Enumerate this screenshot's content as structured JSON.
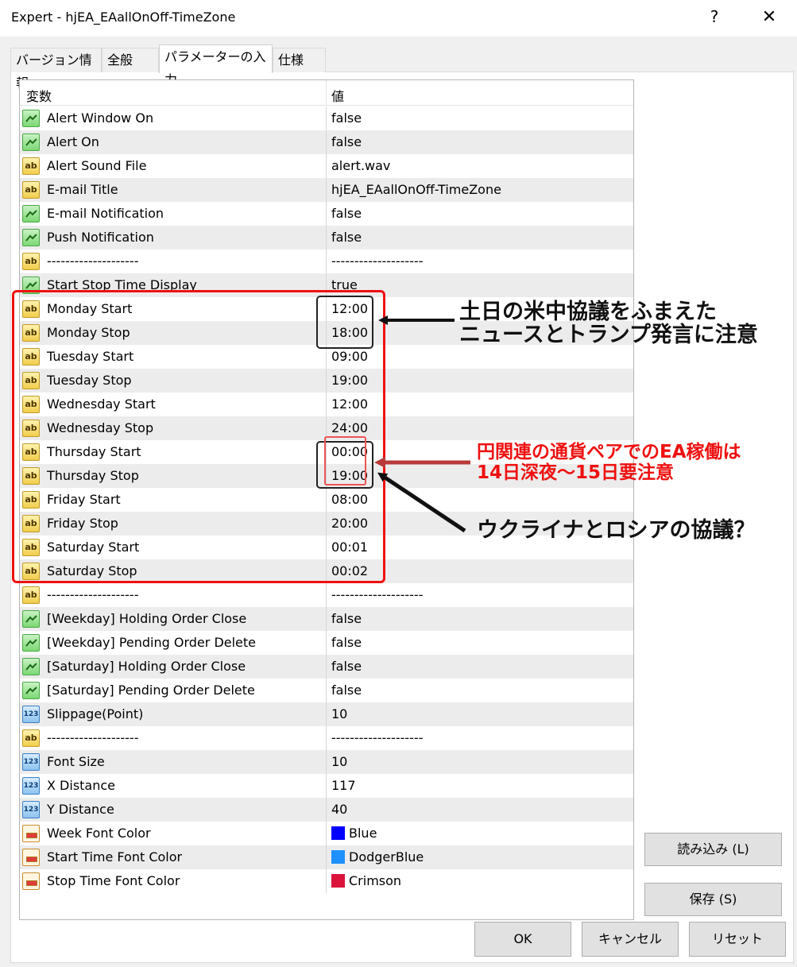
{
  "window": {
    "title": "Expert - hjEA_EAallOnOff-TimeZone",
    "help_glyph": "?",
    "close_glyph": "✕"
  },
  "tabs": [
    {
      "label": "バージョン情報"
    },
    {
      "label": "全般"
    },
    {
      "label": "パラメーターの入力",
      "active": true
    },
    {
      "label": "仕様"
    }
  ],
  "grid": {
    "col_variable": "変数",
    "col_value": "値",
    "rows": [
      {
        "type": "bool",
        "name": "Alert Window On",
        "value": "false"
      },
      {
        "type": "bool",
        "name": "Alert On",
        "value": "false"
      },
      {
        "type": "string",
        "name": "Alert Sound File",
        "value": "alert.wav"
      },
      {
        "type": "string",
        "name": "E-mail Title",
        "value": "hjEA_EAallOnOff-TimeZone"
      },
      {
        "type": "bool",
        "name": "E-mail Notification",
        "value": "false"
      },
      {
        "type": "bool",
        "name": "Push Notification",
        "value": "false"
      },
      {
        "type": "string",
        "name": "--------------------",
        "value": "--------------------"
      },
      {
        "type": "bool",
        "name": "Start Stop Time Display",
        "value": "true"
      },
      {
        "type": "string",
        "name": "Monday Start",
        "value": "12:00"
      },
      {
        "type": "string",
        "name": "Monday Stop",
        "value": "18:00"
      },
      {
        "type": "string",
        "name": "Tuesday Start",
        "value": "09:00"
      },
      {
        "type": "string",
        "name": "Tuesday Stop",
        "value": "19:00"
      },
      {
        "type": "string",
        "name": "Wednesday Start",
        "value": "12:00"
      },
      {
        "type": "string",
        "name": "Wednesday Stop",
        "value": "24:00"
      },
      {
        "type": "string",
        "name": "Thursday Start",
        "value": "00:00"
      },
      {
        "type": "string",
        "name": "Thursday Stop",
        "value": "19:00"
      },
      {
        "type": "string",
        "name": "Friday Start",
        "value": "08:00"
      },
      {
        "type": "string",
        "name": "Friday Stop",
        "value": "20:00"
      },
      {
        "type": "string",
        "name": "Saturday Start",
        "value": "00:01"
      },
      {
        "type": "string",
        "name": "Saturday Stop",
        "value": "00:02"
      },
      {
        "type": "string",
        "name": "--------------------",
        "value": "--------------------"
      },
      {
        "type": "bool",
        "name": "[Weekday]  Holding Order Close",
        "value": "false"
      },
      {
        "type": "bool",
        "name": "[Weekday]  Pending Order Delete",
        "value": "false"
      },
      {
        "type": "bool",
        "name": "[Saturday]   Holding Order Close",
        "value": "false"
      },
      {
        "type": "bool",
        "name": "[Saturday]   Pending Order Delete",
        "value": "false"
      },
      {
        "type": "int",
        "name": "Slippage(Point)",
        "value": "10"
      },
      {
        "type": "string",
        "name": "--------------------",
        "value": "--------------------"
      },
      {
        "type": "int",
        "name": "Font Size",
        "value": "10"
      },
      {
        "type": "int",
        "name": "X Distance",
        "value": "117"
      },
      {
        "type": "int",
        "name": "Y Distance",
        "value": "40"
      },
      {
        "type": "color",
        "name": "Week Font Color",
        "value": "Blue",
        "swatch": "#0000ff"
      },
      {
        "type": "color",
        "name": "Start Time Font Color",
        "value": "DodgerBlue",
        "swatch": "#1e90ff"
      },
      {
        "type": "color",
        "name": "Stop Time Font Color",
        "value": "Crimson",
        "swatch": "#dc143c"
      }
    ]
  },
  "icon_labels": {
    "string": "ab",
    "int": "123"
  },
  "buttons": {
    "load": "読み込み (L)",
    "save": "保存 (S)",
    "ok": "OK",
    "cancel": "キャンセル",
    "reset": "リセット"
  },
  "annotations": {
    "monday_note_line1": "土日の米中協議をふまえた",
    "monday_note_line2": "ニュースとトランプ発言に注意",
    "thursday_red_line1": "円関連の通貨ペアでのEA稼働は",
    "thursday_red_line2": "14日深夜～15日要注意",
    "thursday_black_note": "ウクライナとロシアの協議？",
    "highlight_color": "#ee1111"
  }
}
